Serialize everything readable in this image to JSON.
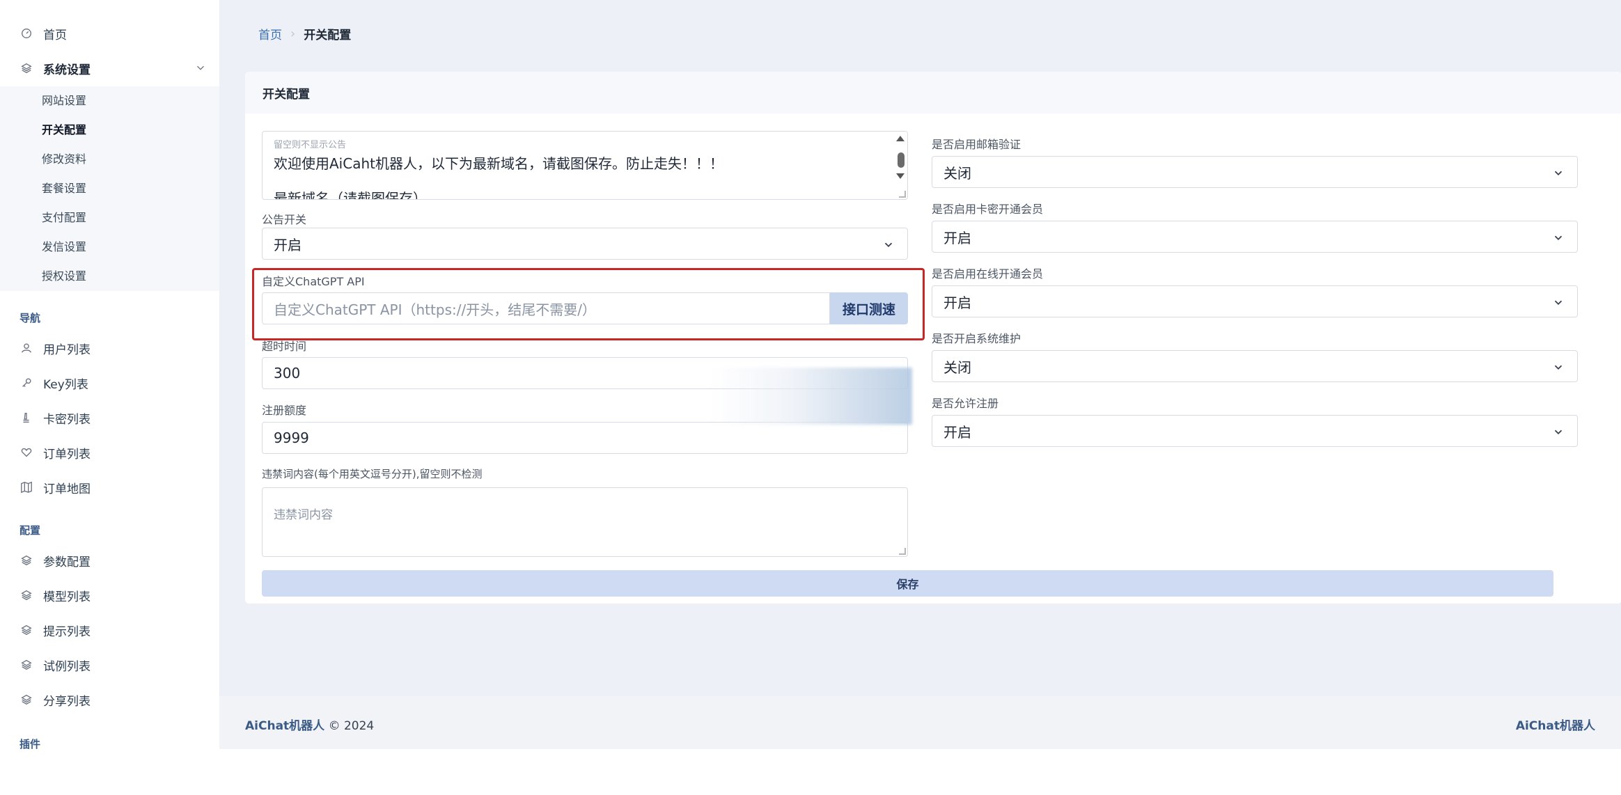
{
  "sidebar": {
    "home": "首页",
    "system_settings": "系统设置",
    "submenu": [
      "网站设置",
      "开关配置",
      "修改资料",
      "套餐设置",
      "支付配置",
      "发信设置",
      "授权设置"
    ],
    "nav_section": "导航",
    "nav_items": [
      "用户列表",
      "Key列表",
      "卡密列表",
      "订单列表",
      "订单地图"
    ],
    "config_section": "配置",
    "config_items": [
      "参数配置",
      "模型列表",
      "提示列表",
      "试例列表",
      "分享列表"
    ],
    "plugin_section": "插件"
  },
  "breadcrumb": {
    "home": "首页",
    "current": "开关配置"
  },
  "card": {
    "title": "开关配置"
  },
  "form_left": {
    "notice_placeholder": "留空则不显示公告",
    "notice_line1": "欢迎使用AiCaht机器人，以下为最新域名，请截图保存。防止走失！！！",
    "notice_line2": "最新域名（请截图保存）",
    "notice_switch_label": "公告开关",
    "notice_switch_value": "开启",
    "api_label": "自定义ChatGPT API",
    "api_placeholder": "自定义ChatGPT API（https://开头，结尾不需要/）",
    "api_test_button": "接口测速",
    "timeout_label": "超时时间",
    "timeout_value": "300",
    "quota_label": "注册额度",
    "quota_value": "9999",
    "banned_label": "违禁词内容(每个用英文逗号分开),留空则不检测",
    "banned_placeholder": "违禁词内容"
  },
  "form_right": {
    "email_verify_label": "是否启用邮箱验证",
    "email_verify_value": "关闭",
    "card_member_label": "是否启用卡密开通会员",
    "card_member_value": "开启",
    "online_member_label": "是否启用在线开通会员",
    "online_member_value": "开启",
    "maintenance_label": "是否开启系统维护",
    "maintenance_value": "关闭",
    "allow_register_label": "是否允许注册",
    "allow_register_value": "开启"
  },
  "save_button": "保存",
  "footer": {
    "brand": "AiChat机器人",
    "copyright": "© 2024",
    "right": "AiChat机器人"
  },
  "colors": {
    "accent": "#3b6fb0",
    "highlight": "#c62828",
    "button_bg": "#cfdaf3"
  }
}
